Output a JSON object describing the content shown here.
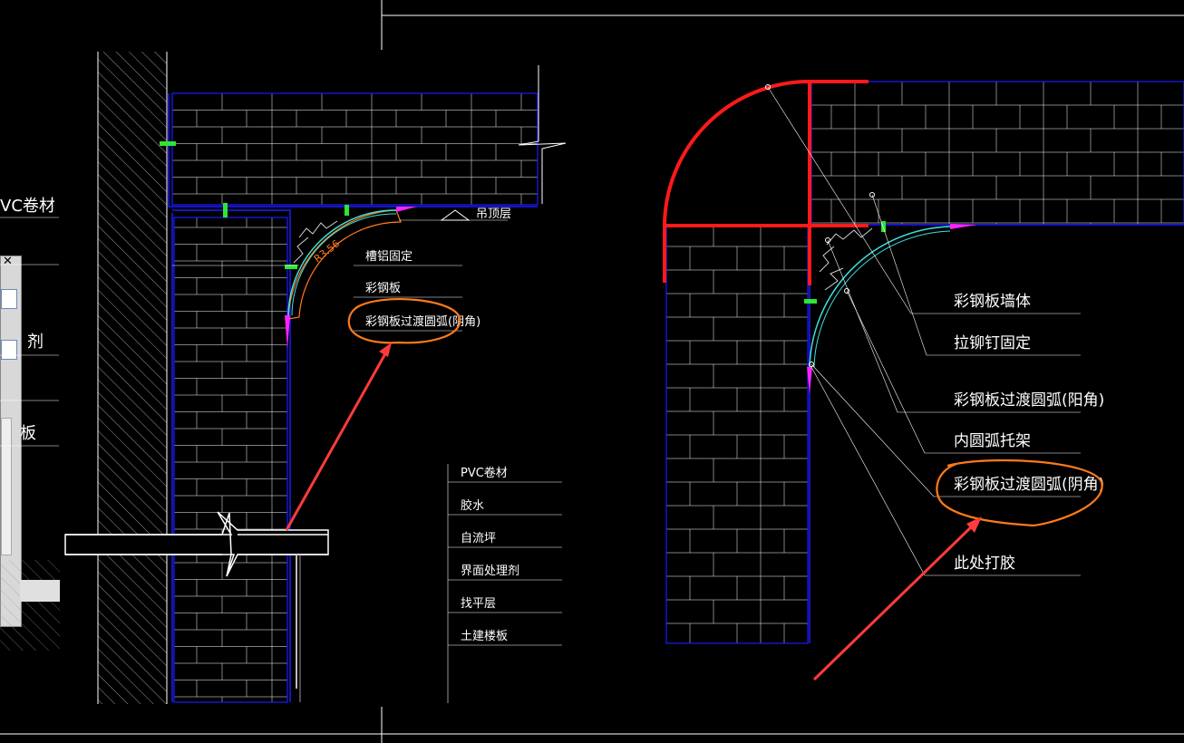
{
  "left_labels_partial": [
    "VC卷材",
    "",
    "剂",
    "",
    "板"
  ],
  "left_drawing": {
    "top_label": "吊顶层",
    "dimension": "R3.56",
    "callouts": [
      "槽铝固定",
      "彩钢板",
      "彩钢板过渡圆弧(阴角)"
    ]
  },
  "floor_layers": [
    "PVC卷材",
    "胶水",
    "自流坪",
    "界面处理剂",
    "找平层",
    "土建楼板"
  ],
  "right_drawing": {
    "callouts": [
      "彩钢板墙体",
      "拉铆钉固定",
      "彩钢板过渡圆弧(阳角)",
      "内圆弧托架",
      "彩钢板过渡圆弧(阴角)",
      "此处打胶"
    ]
  },
  "colors": {
    "background": "#000000",
    "wall_line": "#1a1aff",
    "leader_line": "#ffffff",
    "highlight_arc": "#ff1a1a",
    "annotation": "#ff7a1a",
    "arrow": "#ff3b3b",
    "panel_arc": "#3fe0e0",
    "bracket": "#2ee62e",
    "magenta": "#ff22ff"
  }
}
